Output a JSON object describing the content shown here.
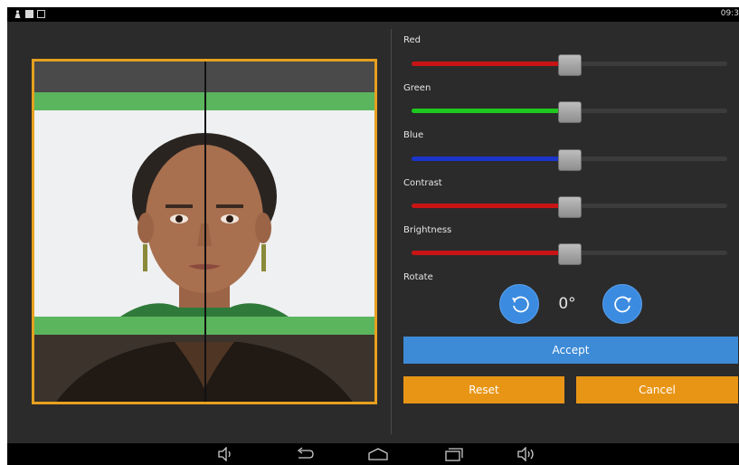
{
  "status_bar": {
    "time": "09:3"
  },
  "sliders": [
    {
      "label": "Red",
      "value_fraction": 0.5,
      "fill_color": "#c81414"
    },
    {
      "label": "Green",
      "value_fraction": 0.5,
      "fill_color": "#1fc81f"
    },
    {
      "label": "Blue",
      "value_fraction": 0.5,
      "fill_color": "#1a35c8"
    },
    {
      "label": "Contrast",
      "value_fraction": 0.5,
      "fill_color": "#c81414"
    },
    {
      "label": "Brightness",
      "value_fraction": 0.5,
      "fill_color": "#c81414"
    }
  ],
  "rotate": {
    "label": "Rotate",
    "value": "0°"
  },
  "buttons": {
    "accept": "Accept",
    "reset": "Reset",
    "cancel": "Cancel"
  },
  "colors": {
    "frame": "#e6a020",
    "accent_blue": "#3d8ad6",
    "accent_orange": "#e89516",
    "guide_band": "#5bb55d"
  },
  "icons": [
    "person-icon",
    "mail-icon",
    "image-icon",
    "rotate-left-icon",
    "rotate-right-icon",
    "volume-down-icon",
    "back-icon",
    "home-icon",
    "recent-apps-icon",
    "volume-up-icon"
  ]
}
